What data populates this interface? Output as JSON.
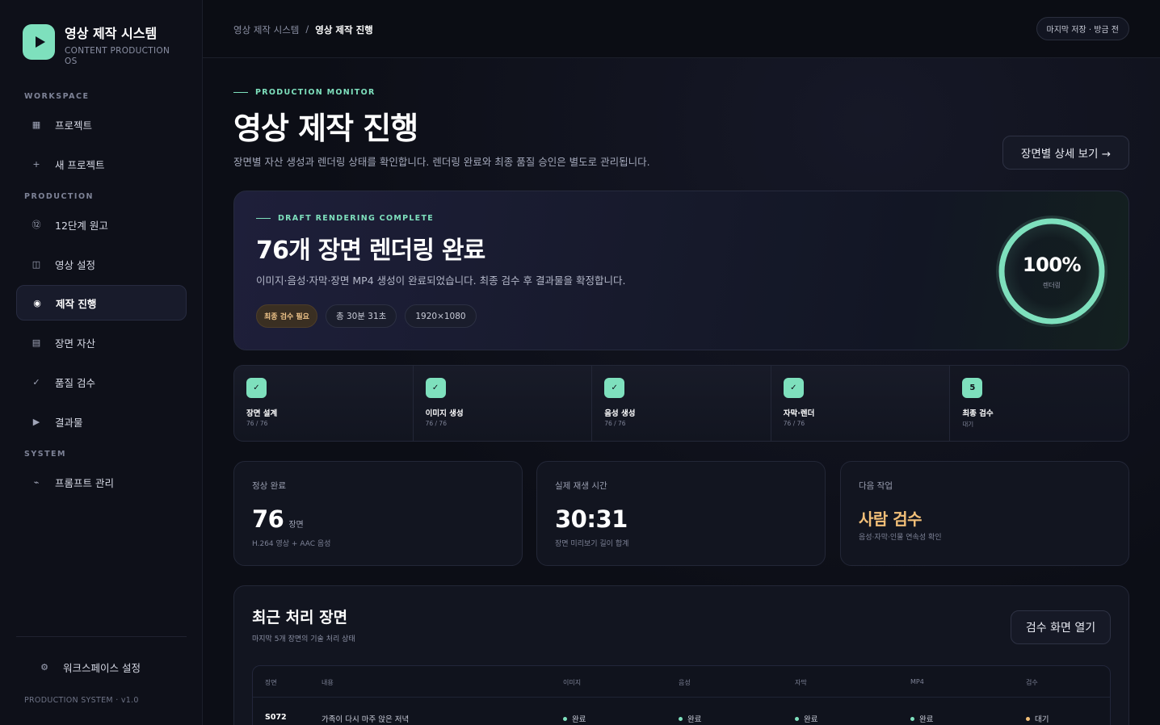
{
  "brand": {
    "title": "영상 제작 시스템",
    "subtitle": "CONTENT PRODUCTION OS"
  },
  "sidebar": {
    "sections": [
      "WORKSPACE",
      "PRODUCTION",
      "SYSTEM"
    ],
    "items": [
      {
        "label": "프로젝트",
        "icon": "grid-icon"
      },
      {
        "label": "새 프로젝트",
        "icon": "plus-icon"
      },
      {
        "label": "12단계 원고",
        "icon": "numbered-circle-icon"
      },
      {
        "label": "영상 설정",
        "icon": "panel-icon"
      },
      {
        "label": "제작 진행",
        "icon": "target-icon"
      },
      {
        "label": "장면 자산",
        "icon": "list-icon"
      },
      {
        "label": "품질 검수",
        "icon": "check-icon"
      },
      {
        "label": "결과물",
        "icon": "play-icon"
      },
      {
        "label": "프롬프트 관리",
        "icon": "prompt-icon"
      }
    ],
    "settings": "워크스페이스 설정",
    "version": "PRODUCTION SYSTEM · v1.0"
  },
  "topbar": {
    "crumb_root": "영상 제작 시스템",
    "crumb_sep": "/",
    "crumb_current": "영상 제작 진행",
    "save_status": "마지막 저장 · 방금 전"
  },
  "header": {
    "eyebrow": "PRODUCTION MONITOR",
    "title": "영상 제작 진행",
    "description": "장면별 자산 생성과 렌더링 상태를 확인합니다. 렌더링 완료와 최종 품질 승인은 별도로 관리됩니다.",
    "detail_button": "장면별 상세 보기 →"
  },
  "hero": {
    "eyebrow": "DRAFT RENDERING COMPLETE",
    "title": "76개 장면 렌더링 완료",
    "description": "이미지·음성·자막·장면 MP4 생성이 완료되었습니다. 최종 검수 후 결과물을 확정합니다.",
    "chips": [
      "최종 검수 필요",
      "총 30분 31초",
      "1920×1080"
    ],
    "progress": 1.0,
    "progress_text": "100%",
    "progress_label": "렌더링",
    "accent": "#7ee0bd"
  },
  "steps": [
    {
      "badge": "✓",
      "name": "장면 설계",
      "count": "76 / 76"
    },
    {
      "badge": "✓",
      "name": "이미지 생성",
      "count": "76 / 76"
    },
    {
      "badge": "✓",
      "name": "음성 생성",
      "count": "76 / 76"
    },
    {
      "badge": "✓",
      "name": "자막·렌더",
      "count": "76 / 76"
    },
    {
      "badge": "5",
      "name": "최종 검수",
      "count": "대기"
    }
  ],
  "stats": [
    {
      "label": "정상 완료",
      "value": "76",
      "unit": "장면",
      "sub": "H.264 영상 + AAC 음성"
    },
    {
      "label": "실제 재생 시간",
      "value": "30:31",
      "sub": "장면 미리보기 길이 합계"
    },
    {
      "label": "다음 작업",
      "value": "사람 검수",
      "sub": "음성·자막·인물 연속성 확인"
    }
  ],
  "recent": {
    "title": "최근 처리 장면",
    "subtitle": "마지막 5개 장면의 기술 처리 상태",
    "review_button": "검수 화면 열기",
    "columns": [
      "장면",
      "내용",
      "이미지",
      "음성",
      "자막",
      "MP4",
      "검수"
    ],
    "rows": [
      {
        "id": "S072",
        "content": "가족이 다시 마주 앉은 저녁",
        "image": "완료",
        "audio": "완료",
        "subtitle": "완료",
        "mp4": "완료",
        "review": "대기"
      }
    ]
  }
}
